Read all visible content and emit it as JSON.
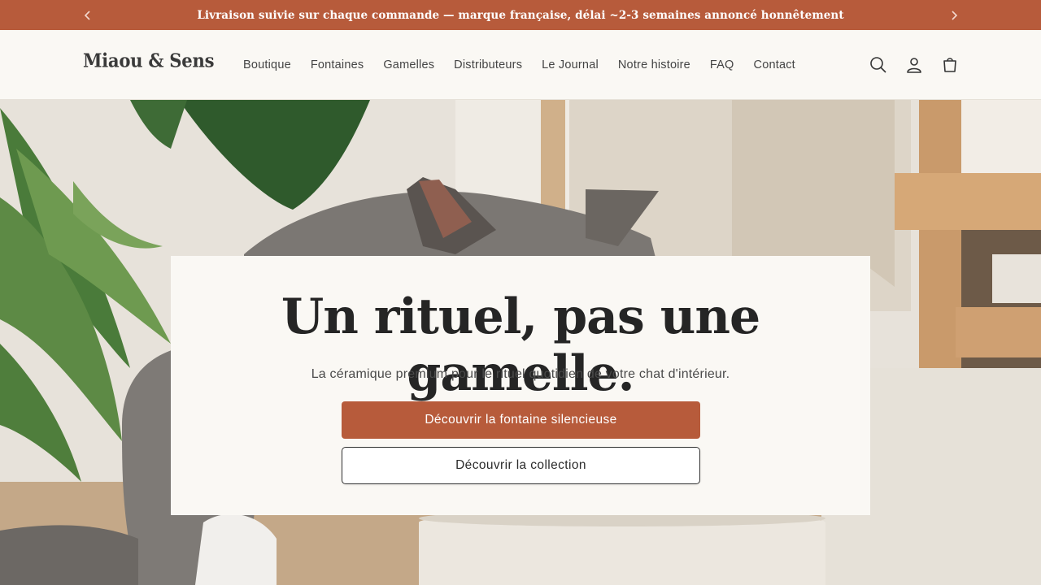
{
  "announcement": {
    "text": "Livraison suivie sur chaque commande — marque française, délai ~2-3 semaines annoncé honnêtement",
    "prev_icon": "chevron-left-icon",
    "next_icon": "chevron-right-icon"
  },
  "header": {
    "logo": "Miaou & Sens",
    "nav": [
      "Boutique",
      "Fontaines",
      "Gamelles",
      "Distributeurs",
      "Le Journal",
      "Notre histoire",
      "FAQ",
      "Contact"
    ],
    "icons": [
      "search-icon",
      "account-icon",
      "cart-icon"
    ]
  },
  "hero": {
    "title": "Un rituel, pas une gamelle.",
    "subtitle": "La céramique premium pour le rituel quotidien de votre chat d'intérieur.",
    "primary_cta": "Découvrir la fontaine silencieuse",
    "secondary_cta": "Découvrir la collection"
  },
  "colors": {
    "accent": "#b75b3b",
    "background": "#faf8f4",
    "text": "#2b2b2b"
  }
}
